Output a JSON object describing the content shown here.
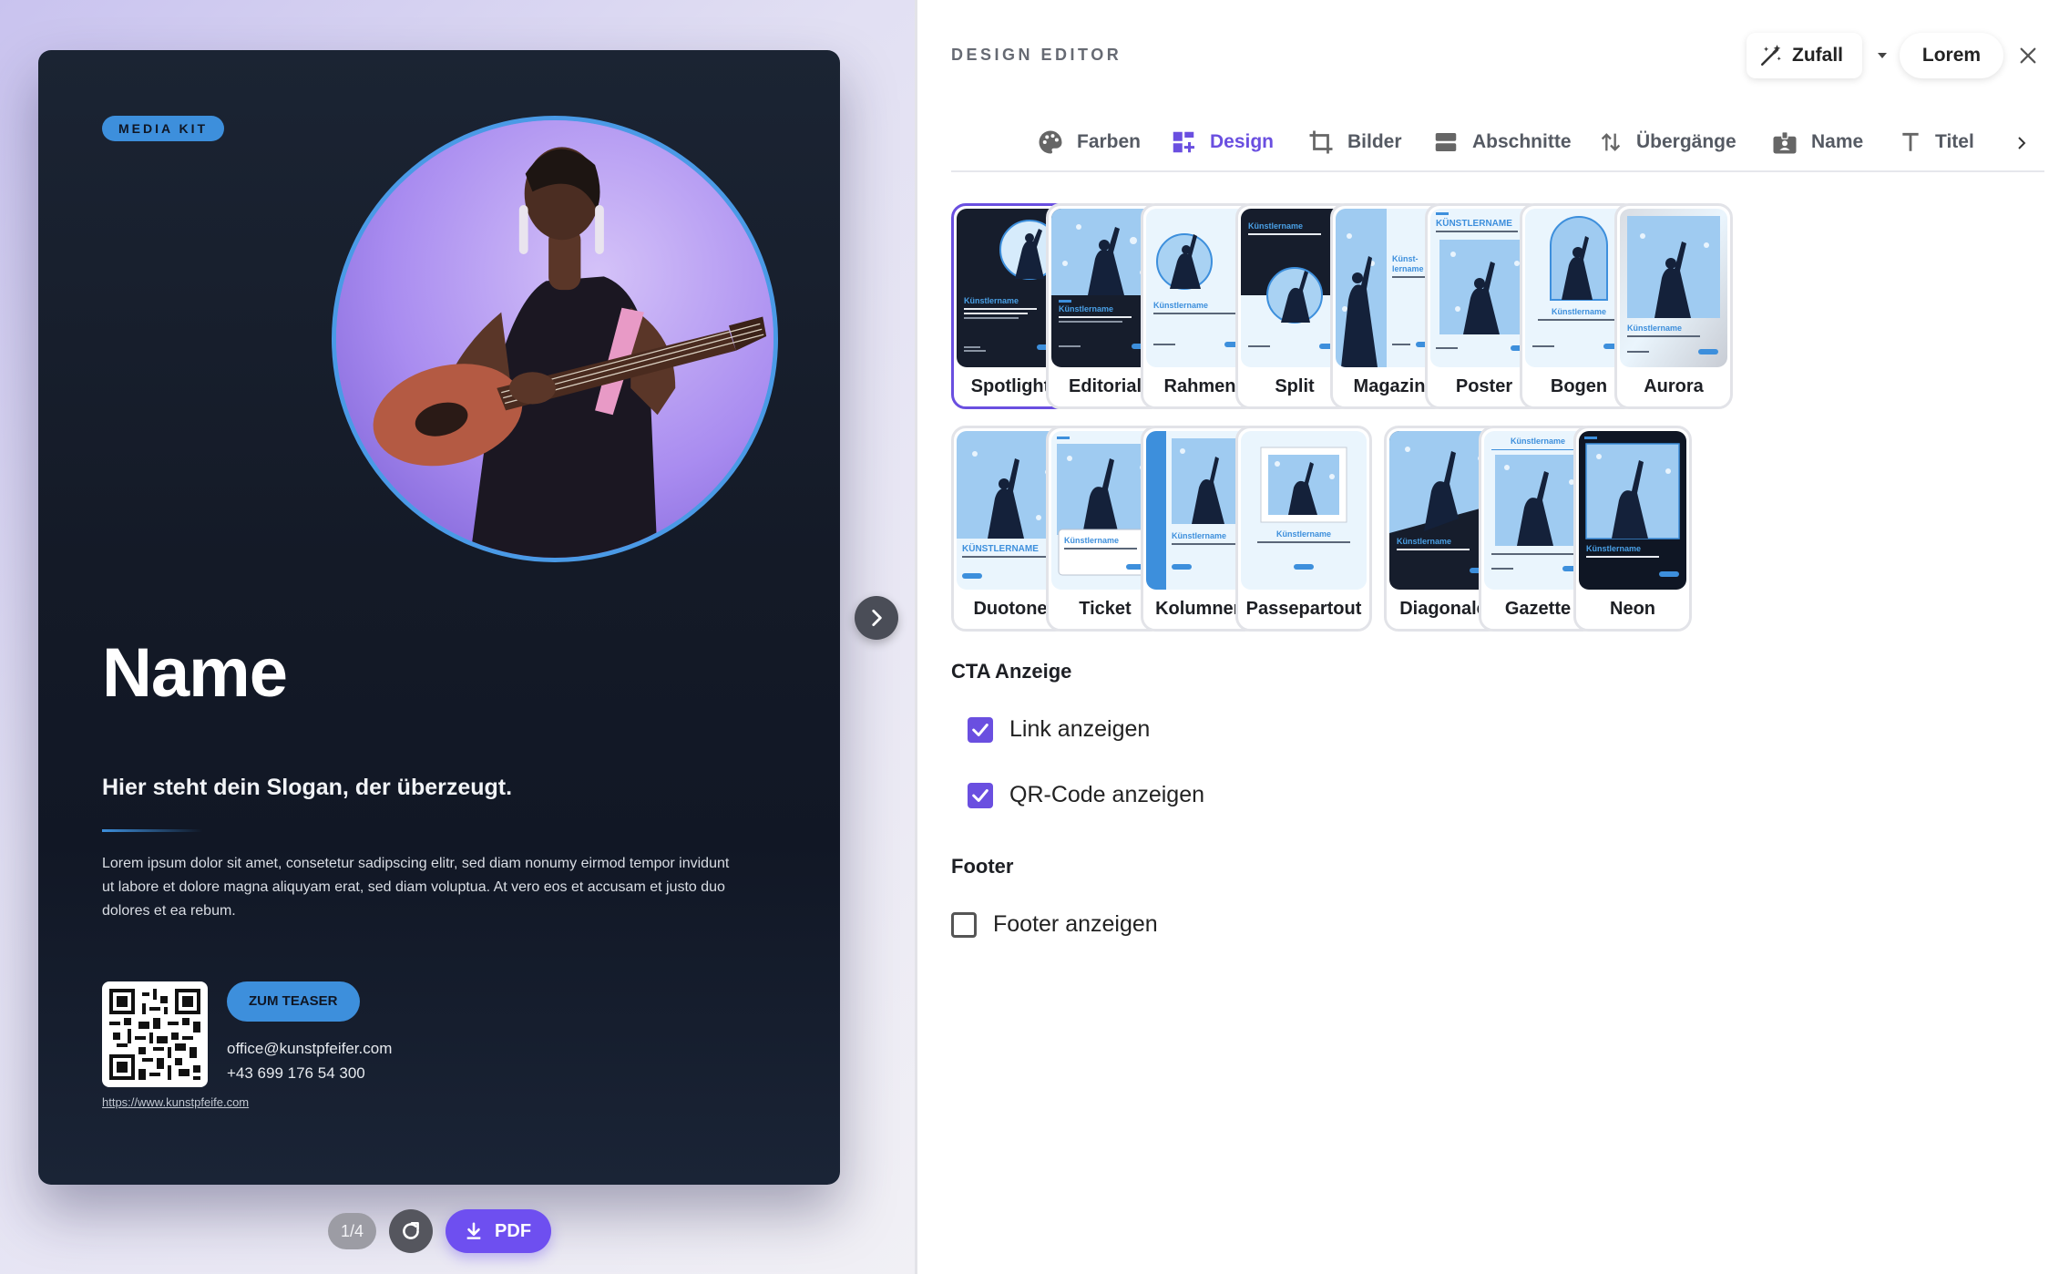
{
  "preview": {
    "badge": "MEDIA KIT",
    "name": "Name",
    "slogan": "Hier steht dein Slogan, der überzeugt.",
    "body": "Lorem ipsum dolor sit amet, consetetur sadipscing elitr, sed diam nonumy eirmod tempor invidunt ut labore et dolore magna aliquyam erat, sed diam voluptua. At vero eos et accusam et justo duo dolores et ea rebum.",
    "cta_label": "ZUM TEASER",
    "qr_url": "https://www.kunstpfeife.com",
    "email": "office@kunstpfeifer.com",
    "phone": "+43 699 176 54 300",
    "page_counter": "1/4",
    "pdf_label": "PDF"
  },
  "editor": {
    "title": "DESIGN EDITOR",
    "random_label": "Zufall",
    "lorem_label": "Lorem",
    "tabs": [
      {
        "label": "Farben",
        "icon": "palette-icon"
      },
      {
        "label": "Design",
        "icon": "dashboard-add-icon",
        "active": true
      },
      {
        "label": "Bilder",
        "icon": "crop-icon"
      },
      {
        "label": "Abschnitte",
        "icon": "sections-icon"
      },
      {
        "label": "Übergänge",
        "icon": "swap-vertical-icon"
      },
      {
        "label": "Name",
        "icon": "badge-icon"
      },
      {
        "label": "Titel",
        "icon": "text-icon"
      }
    ],
    "layouts": [
      {
        "label": "Spotlight",
        "selected": true
      },
      {
        "label": "Editorial"
      },
      {
        "label": "Rahmen"
      },
      {
        "label": "Split"
      },
      {
        "label": "Magazin"
      },
      {
        "label": "Poster"
      },
      {
        "label": "Bogen"
      },
      {
        "label": "Aurora"
      },
      {
        "label": "Duotone"
      },
      {
        "label": "Ticket"
      },
      {
        "label": "Kolumnen"
      },
      {
        "label": "Passepartout"
      },
      {
        "label": "Diagonale"
      },
      {
        "label": "Gazette"
      },
      {
        "label": "Neon"
      }
    ],
    "thumb_texts": {
      "kuenstlername": "Künstlername",
      "kuenstlername_caps": "KÜNSTLERNAME",
      "kuenst": "Künst-",
      "lername": "lername"
    },
    "cta_section": {
      "title": "CTA Anzeige",
      "link_label": "Link anzeigen",
      "link_checked": true,
      "qr_label": "QR-Code anzeigen",
      "qr_checked": true
    },
    "footer_section": {
      "title": "Footer",
      "footer_label": "Footer anzeigen",
      "footer_checked": false
    }
  },
  "colors": {
    "accent": "#6a4fe0",
    "kit_blue": "#3d8fdc",
    "kit_dark": "#141a27"
  }
}
